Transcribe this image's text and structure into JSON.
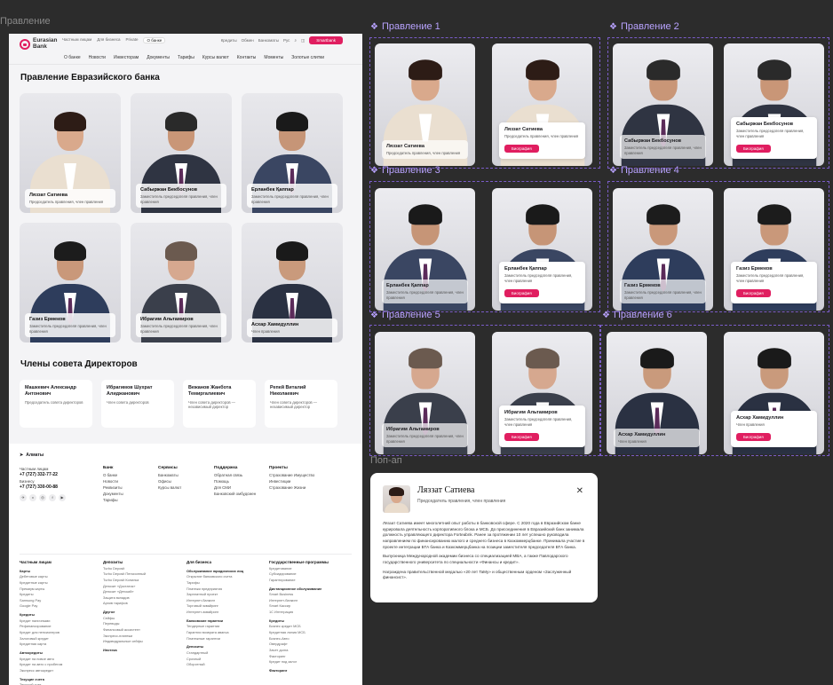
{
  "labels": {
    "main_frame": "Правление",
    "popup_frame": "Поп-ап",
    "variants": [
      "Правление 1",
      "Правление 2",
      "Правление 3",
      "Правление 4",
      "Правление 5",
      "Правление 6"
    ]
  },
  "header": {
    "logo_line1": "Eurasian",
    "logo_line2": "Bank",
    "top_links": [
      "Частным лицам",
      "Для бизнеса",
      "Private",
      "О банке"
    ],
    "top_right": [
      "Кредиты",
      "Обмен",
      "Банкоматы",
      "Рус"
    ],
    "cta": "Smartbank",
    "nav": [
      "О банке",
      "Новости",
      "Инвесторам",
      "Документы",
      "Тарифы",
      "Курсы валют",
      "Контакты",
      "Моменты",
      "Золотые слитки"
    ]
  },
  "board": {
    "title": "Правление Евразийского банка",
    "members": [
      {
        "name": "Ляззат Сатиева",
        "position": "Председатель правления, член правления",
        "skin": "#d9a98c",
        "hair": "#2d1c16",
        "suit": "#eadfd0"
      },
      {
        "name": "Сабыржан Бекбосунов",
        "position": "Заместитель председателя правления, член правления",
        "skin": "#c99677",
        "hair": "#2a2a2a",
        "suit": "#2f3442"
      },
      {
        "name": "Ерланбек Қаппар",
        "position": "Заместитель председателя правления, член правления",
        "skin": "#c69577",
        "hair": "#1a1a1a",
        "suit": "#3a4662"
      },
      {
        "name": "Газиз Ермеков",
        "position": "Заместитель председателя правления, член правления",
        "skin": "#c9987a",
        "hair": "#1c1c1c",
        "suit": "#2e3d5c"
      },
      {
        "name": "Ибрагим Альтамиров",
        "position": "Заместитель председателя правления, член правления",
        "skin": "#d6a88f",
        "hair": "#6b5a4f",
        "suit": "#3a3f4b"
      },
      {
        "name": "Асхар Хамидуллин",
        "position": "Член правления",
        "skin": "#c99a7c",
        "hair": "#1a1a1a",
        "suit": "#2a3142"
      }
    ]
  },
  "directors": {
    "title": "Члены совета Директоров",
    "items": [
      {
        "name": "Машкевич Александр Антонович",
        "position": "Председатель совета директоров"
      },
      {
        "name": "Ибрагимов Шухрат Алиджанович",
        "position": "Член совета директоров"
      },
      {
        "name": "Вежанов Жанбота Темиргалиевич",
        "position": "Член совета директоров — независимый директор"
      },
      {
        "name": "Репей Виталий Николаевич",
        "position": "Член совета директоров — независимый директор"
      }
    ]
  },
  "footer": {
    "city": "Алматы",
    "contacts": [
      {
        "label": "Частным лицам",
        "phone": "+7 (727) 332-77-22"
      },
      {
        "label": "Бизнесу",
        "phone": "+7 (727) 330-00-88"
      }
    ],
    "columns": [
      {
        "title": "Банк",
        "items": [
          "О банке",
          "Новости",
          "Реквизиты",
          "Документы",
          "Тарифы"
        ]
      },
      {
        "title": "Сервисы",
        "items": [
          "Банкоматы",
          "Офисы",
          "Курсы валют"
        ]
      },
      {
        "title": "Поддержка",
        "items": [
          "Обратная связь",
          "Помощь",
          "Для СМИ",
          "Банковский омбудсмен"
        ]
      },
      {
        "title": "Проекты",
        "items": [
          "Страхование Имущество",
          "Инвестиции",
          "Страхование Жизни"
        ]
      }
    ],
    "sitemap": [
      {
        "title": "Частным лицам",
        "groups": [
          {
            "sub": "Карты",
            "items": [
              "Дебетовые карты",
              "Кредитные карты",
              "Премиум карты",
              "Кредиты",
              "Samsung Pay",
              "Google Pay"
            ]
          },
          {
            "sub": "Кредиты",
            "items": [
              "Кредит наличными",
              "Рефинансирование",
              "Кредит для пенсионеров",
              "Залоговый кредит",
              "Кредитная карта"
            ]
          },
          {
            "sub": "Автокредиты",
            "items": [
              "Кредит на новое авто",
              "Кредит на авто с пробегом",
              "Экспресс автокредит"
            ]
          },
          {
            "sub": "Текущие счета",
            "items": [
              "Текущий счет",
              "Детский счет"
            ]
          }
        ]
      },
      {
        "title": "Депозиты",
        "groups": [
          {
            "sub": "",
            "items": [
              "Turbo Deposit",
              "Turbo Deposit Пенсионный",
              "Turbo Deposit Копилка",
              "Депозит «Достаток»",
              "Депозит «Детский»",
              "Защита вкладов",
              "Архив тарифов"
            ]
          },
          {
            "sub": "Другое",
            "items": [
              "Сейфы",
              "Переводы",
              "Финансовый ассистент",
              "Экспресс-платежи",
              "Индивидуальные сейфы"
            ]
          },
          {
            "sub": "Ипотека",
            "items": []
          }
        ]
      },
      {
        "title": "Для бизнеса",
        "groups": [
          {
            "sub": "Обслуживание юридических лиц",
            "items": [
              "Открытие банковского счета",
              "Тарифы",
              "Платежи предприятия",
              "Зарплатный проект",
              "Интернет-банкинг",
              "Торговый эквайринг",
              "Интернет-эквайринг"
            ]
          },
          {
            "sub": "Банковские гарантии",
            "items": [
              "Тендерные гарантии",
              "Гарантии возврата аванса",
              "Платежные гарантии"
            ]
          },
          {
            "sub": "Депозиты",
            "items": [
              "Стандартный",
              "Срочный",
              "Оборотный"
            ]
          }
        ]
      },
      {
        "title": "Государственные программы",
        "groups": [
          {
            "sub": "",
            "items": [
              "Кредитование",
              "Субсидирование",
              "Гарантирование"
            ]
          },
          {
            "sub": "Дистанционное обслуживание",
            "items": [
              "Smart Business",
              "Интернет-банкинг",
              "Smart Кассир",
              "1С Интеграция"
            ]
          },
          {
            "sub": "Кредиты",
            "items": [
              "Бизнес кредит МСБ",
              "Кредитная линия МСБ",
              "Бизнес-Авто",
              "Овердрафт",
              "Зачет долга",
              "Факторинг",
              "Кредит под залог"
            ]
          },
          {
            "sub": "Факторинг",
            "items": []
          }
        ]
      }
    ]
  },
  "variant_cards": [
    {
      "member": 0,
      "style": "plain"
    },
    {
      "member": 0,
      "style": "button"
    },
    {
      "member": 1,
      "style": "plain"
    },
    {
      "member": 1,
      "style": "button"
    },
    {
      "member": 2,
      "style": "plain"
    },
    {
      "member": 2,
      "style": "button"
    },
    {
      "member": 3,
      "style": "plain"
    },
    {
      "member": 3,
      "style": "button"
    },
    {
      "member": 4,
      "style": "plain"
    },
    {
      "member": 4,
      "style": "button"
    },
    {
      "member": 5,
      "style": "plain"
    },
    {
      "member": 5,
      "style": "button"
    }
  ],
  "bio_button": "Биография",
  "popup": {
    "name": "Ляззат Сатиева",
    "position": "Председатель правления, член правления",
    "paragraphs": [
      "Ляззат Сатиева имеет многолетний опыт работы в банковской сфере. С 2020 года в Евразийском банке курировала деятельность корпоративного блока и МСБ. До присоединения в Евразийский банк занимала должность управляющего директора Forteabnk. Ранее за протяжении 10 лет успешно руководила направлением по финансированию малого и среднего бизнеса в Казкоммерцбанке. Принимала участие в проекте интеграции БТА банка и Казкоммерцбанка на позиции заместителя председателя БТА банка.",
      "Выпускница Международной академии бизнеса со специализацией MBA, а также Павлодарского государственного университета по специальности «Финансы и кредит».",
      "Награждена правительственной медалью «20 лет TaMy» и общественным орденом «Заслуженный финансист»."
    ],
    "close": "✕"
  }
}
